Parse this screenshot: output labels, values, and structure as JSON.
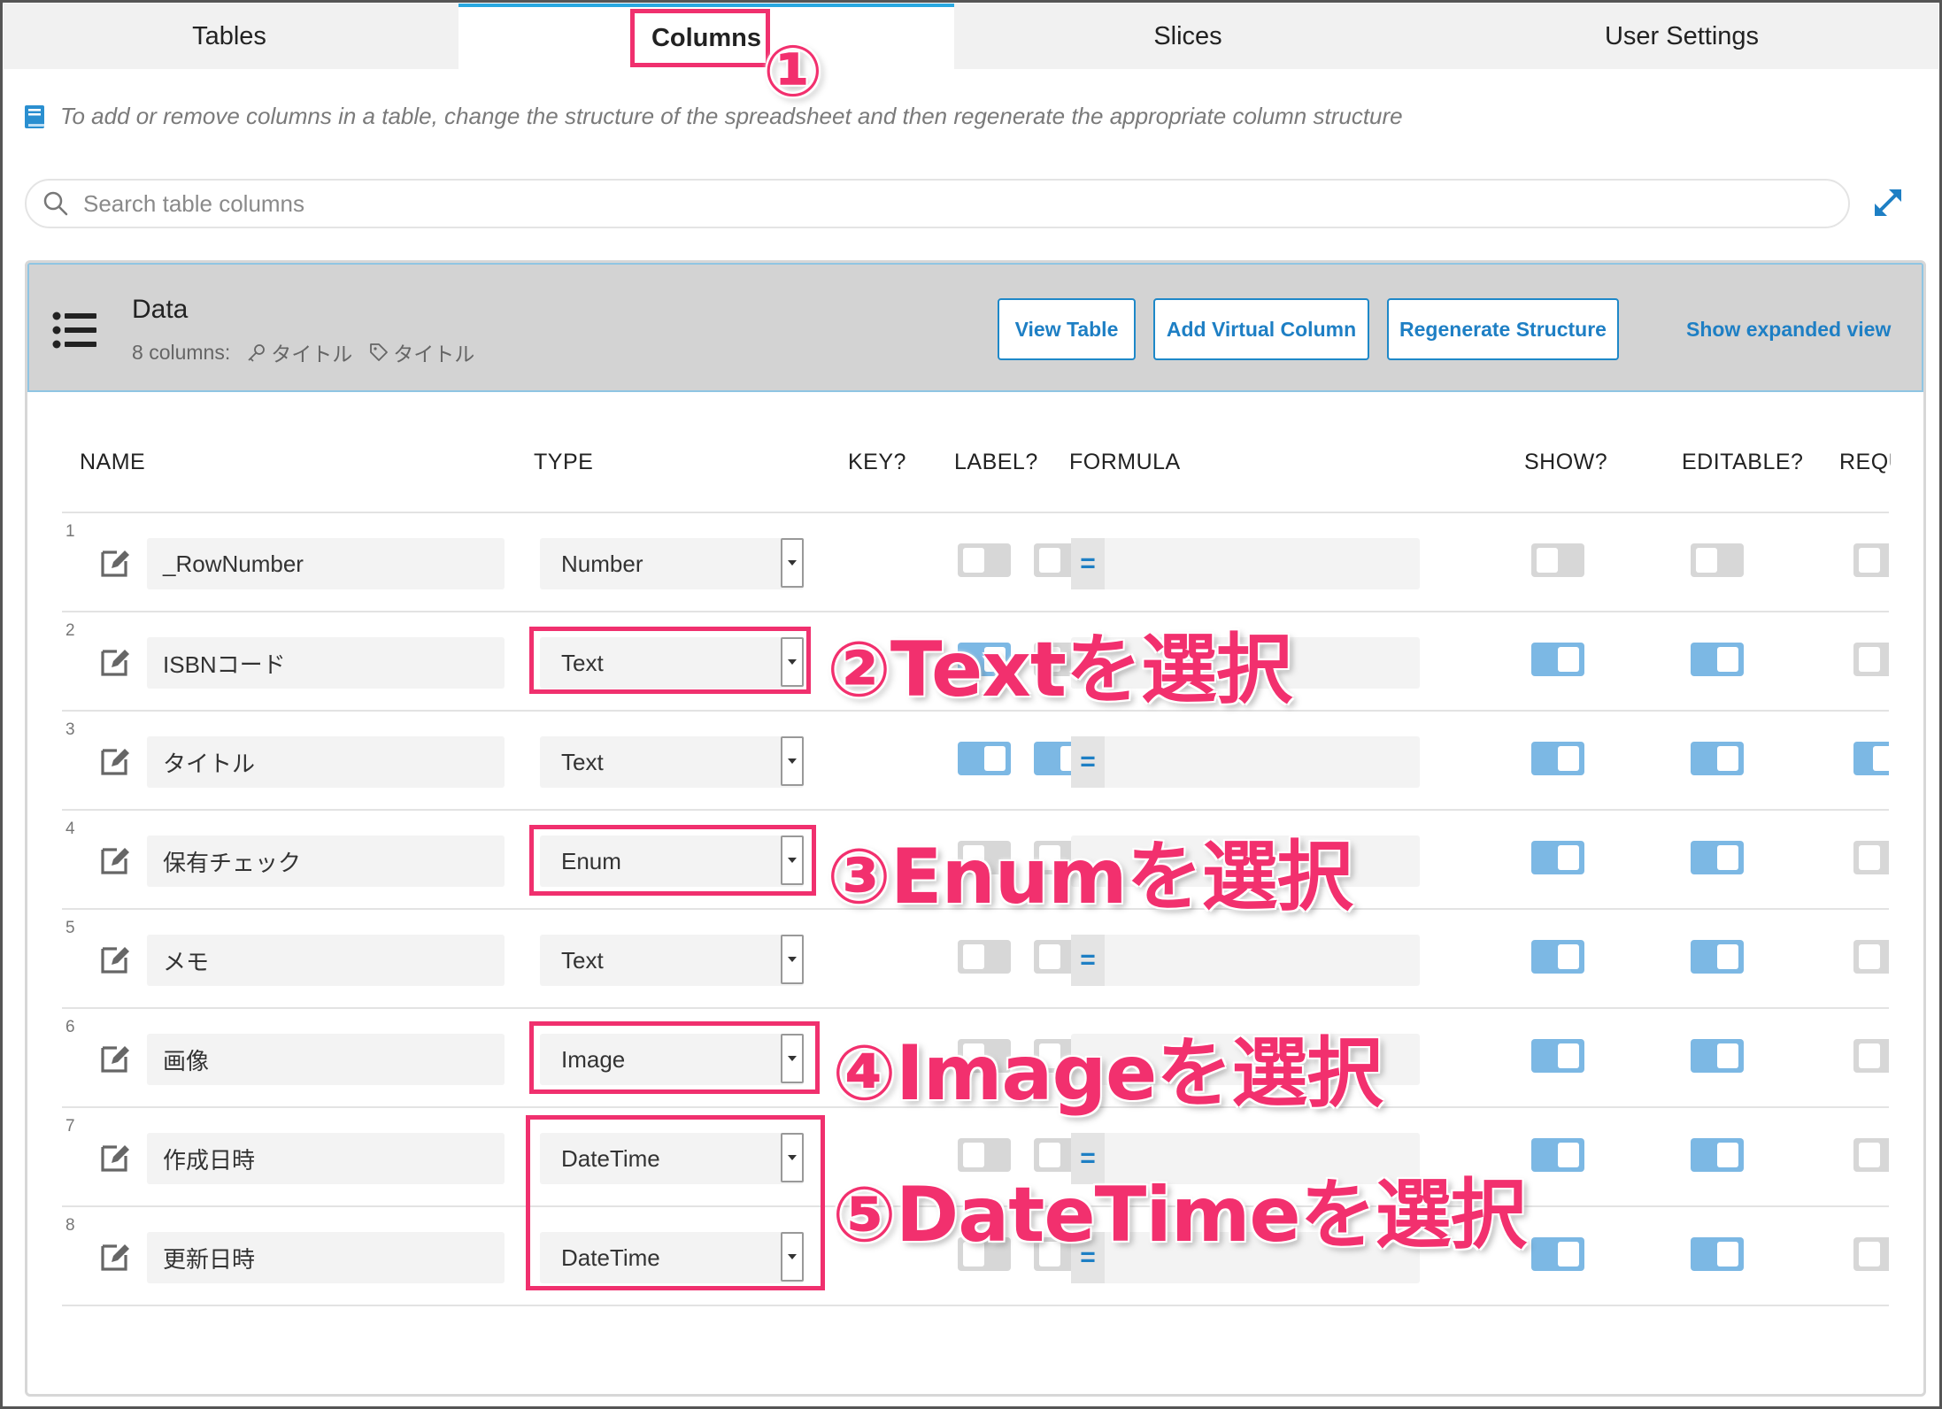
{
  "tabs": [
    "Tables",
    "Columns",
    "Slices",
    "User Settings"
  ],
  "info_text": "To add or remove columns in a table, change the structure of the spreadsheet and then regenerate the appropriate column structure",
  "search": {
    "placeholder": "Search table columns"
  },
  "table": {
    "name": "Data",
    "column_count": "8",
    "columns_suffix": "columns:",
    "key_label": "タイトル",
    "label_label": "タイトル",
    "buttons": {
      "view": "View Table",
      "add_virtual": "Add Virtual Column",
      "regenerate": "Regenerate Structure"
    },
    "expanded_link": "Show expanded view"
  },
  "headers": {
    "name": "NAME",
    "type": "TYPE",
    "key": "KEY?",
    "label": "LABEL?",
    "formula": "FORMULA",
    "show": "SHOW?",
    "editable": "EDITABLE?",
    "required": "REQU"
  },
  "rows": [
    {
      "num": "1",
      "name": "_RowNumber",
      "type": "Number",
      "key": false,
      "label": false,
      "formula": "=",
      "show": false,
      "editable": false,
      "required": false
    },
    {
      "num": "2",
      "name": "ISBNコード",
      "type": "Text",
      "key": true,
      "label": false,
      "formula": "",
      "show": true,
      "editable": true,
      "required": false
    },
    {
      "num": "3",
      "name": "タイトル",
      "type": "Text",
      "key": true,
      "label": true,
      "formula": "=",
      "show": true,
      "editable": true,
      "required": true
    },
    {
      "num": "4",
      "name": "保有チェック",
      "type": "Enum",
      "key": false,
      "label": false,
      "formula": "",
      "show": true,
      "editable": true,
      "required": false
    },
    {
      "num": "5",
      "name": "メモ",
      "type": "Text",
      "key": false,
      "label": false,
      "formula": "=",
      "show": true,
      "editable": true,
      "required": false
    },
    {
      "num": "6",
      "name": "画像",
      "type": "Image",
      "key": false,
      "label": false,
      "formula": "",
      "show": true,
      "editable": true,
      "required": false
    },
    {
      "num": "7",
      "name": "作成日時",
      "type": "DateTime",
      "key": false,
      "label": false,
      "formula": "=",
      "show": true,
      "editable": true,
      "required": false
    },
    {
      "num": "8",
      "name": "更新日時",
      "type": "DateTime",
      "key": false,
      "label": false,
      "formula": "=",
      "show": true,
      "editable": true,
      "required": false
    }
  ],
  "annotations": {
    "a1": "①",
    "a2": "②Textを選択",
    "a3": "③Enumを選択",
    "a4": "④Imageを選択",
    "a5": "⑤DateTimeを選択"
  },
  "colors": {
    "accent": "#29a8e0",
    "link": "#1e7fc4",
    "annotation": "#f2306e",
    "toggle_on": "#7cb8e4",
    "toggle_off": "#d7d7d7"
  }
}
